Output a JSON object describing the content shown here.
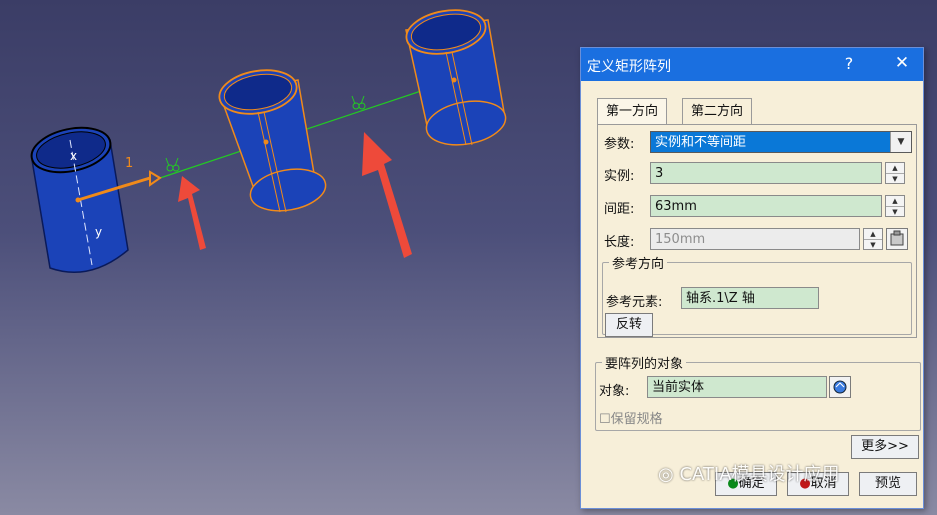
{
  "viewport": {
    "axis_label_x": "x",
    "axis_label_y": "y",
    "direction_number": "1"
  },
  "dialog": {
    "title": "定义矩形阵列",
    "help": "?",
    "close": "✕",
    "tabs": [
      {
        "label": "第一方向",
        "active": true
      },
      {
        "label": "第二方向",
        "active": false
      }
    ],
    "params": {
      "label": "参数:",
      "value": "实例和不等间距"
    },
    "instances": {
      "label": "实例:",
      "value": "3"
    },
    "spacing": {
      "label": "间距:",
      "value": "63mm"
    },
    "length": {
      "label": "长度:",
      "value": "150mm"
    },
    "reference": {
      "legend": "参考方向",
      "element_label": "参考元素:",
      "element_value": "轴系.1\\Z 轴",
      "reverse_button": "反转"
    },
    "object_group": {
      "legend": "要阵列的对象",
      "object_label": "对象:",
      "object_value": "当前实体",
      "keep_spec": "保留规格"
    },
    "more_button": "更多>>",
    "ok_button": "确定",
    "cancel_button": "取消",
    "preview_button": "预览"
  },
  "watermark": "CATIA模具设计应用",
  "colors": {
    "cylinder": "#1b43b8",
    "edge": "#f08a1a",
    "axis": "#22cc22",
    "arrow": "#ee4a3a",
    "title_bar": "#1a6fe0"
  }
}
